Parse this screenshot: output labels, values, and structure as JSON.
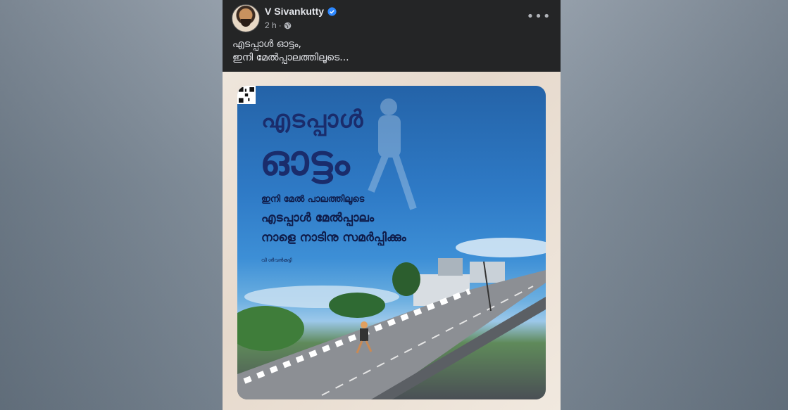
{
  "post": {
    "author": "V Sivankutty",
    "time": "2 h",
    "caption_line1": "എടപ്പാൾ ഓട്ടം,",
    "caption_line2": "ഇനി മേൽപ്പാലത്തിലൂടെ...",
    "more_label": "•••"
  },
  "poster": {
    "title_line1": "എടപ്പാൾ",
    "title_line2": "ഓട്ടം",
    "line1": "ഇനി മേൽ പാലത്തിലൂടെ",
    "line2": "എടപ്പാൾ മേൽപ്പാലം",
    "line3": "നാളെ നാടിനു സമർപ്പിക്കും",
    "signature": "വി ശിവൻകുട്ടി"
  },
  "colors": {
    "post_bg": "#242526",
    "poster_title": "#1a2c6b",
    "sky": "#2f7bc7",
    "verified": "#2d88ff"
  },
  "icons": [
    "verified-badge-icon",
    "globe-icon",
    "more-options-icon",
    "qr-code-icon"
  ]
}
